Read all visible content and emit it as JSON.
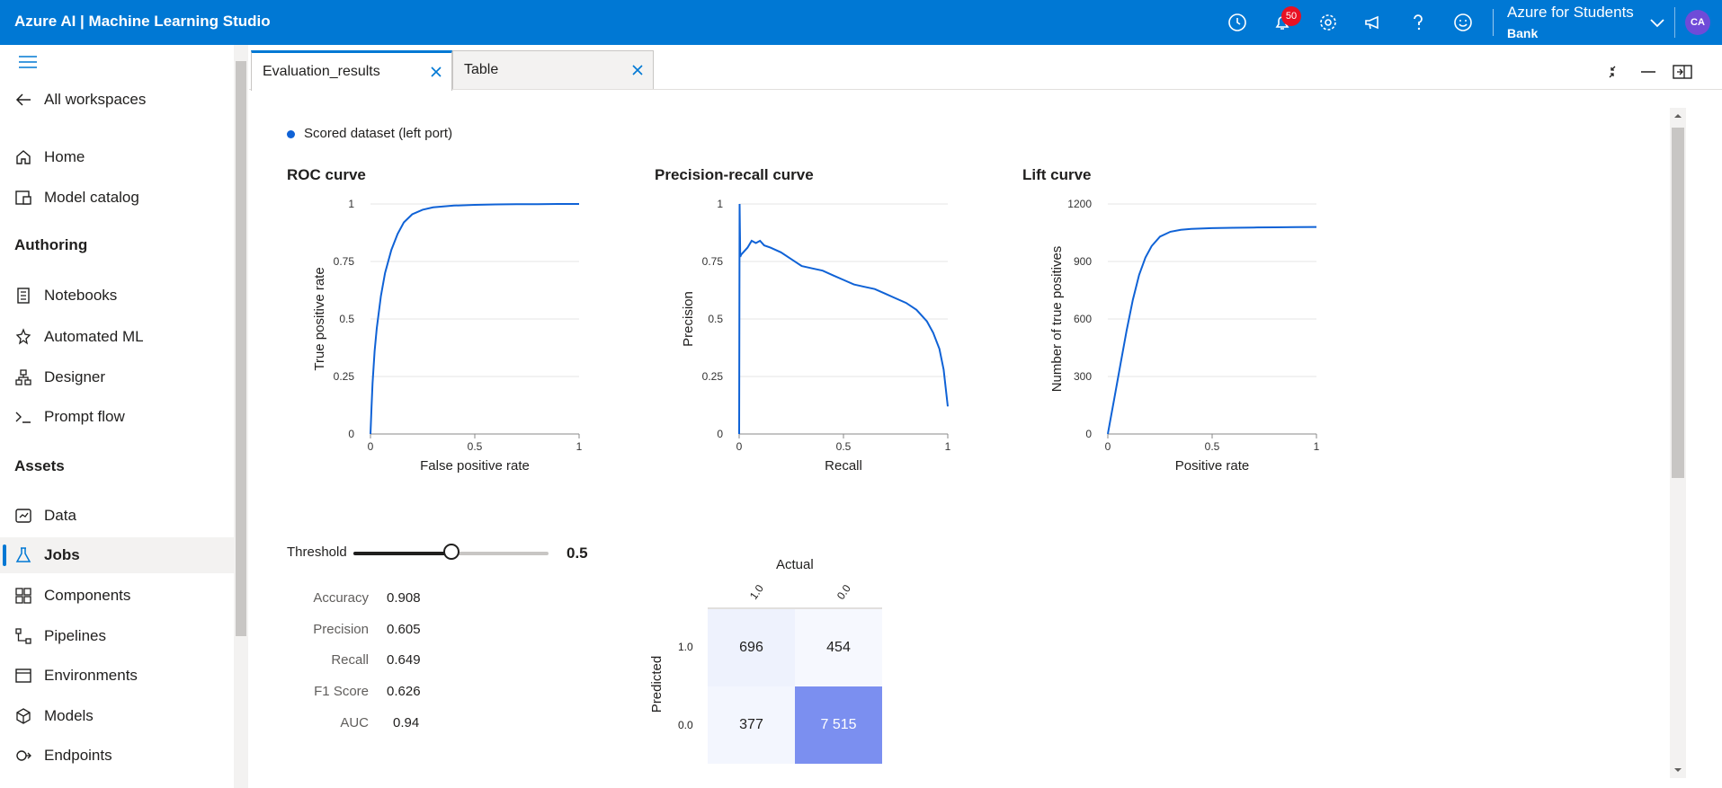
{
  "topbar": {
    "app_title": "Azure AI | Machine Learning Studio",
    "notification_count": "50",
    "account_name": "Azure for Students",
    "workspace_name": "Bank",
    "avatar_initials": "CA",
    "icons": [
      "clock-icon",
      "bell-icon",
      "gear-icon",
      "megaphone-icon",
      "help-icon",
      "smiley-icon",
      "chevron-down-icon"
    ]
  },
  "sidebar": {
    "back_label": "All workspaces",
    "items_top": [
      {
        "label": "Home",
        "icon": "home-icon"
      },
      {
        "label": "Model catalog",
        "icon": "catalog-icon"
      }
    ],
    "section_authoring": "Authoring",
    "items_authoring": [
      {
        "label": "Notebooks",
        "icon": "notebook-icon"
      },
      {
        "label": "Automated ML",
        "icon": "automl-icon"
      },
      {
        "label": "Designer",
        "icon": "designer-icon"
      },
      {
        "label": "Prompt flow",
        "icon": "prompt-icon"
      }
    ],
    "section_assets": "Assets",
    "items_assets": [
      {
        "label": "Data",
        "icon": "data-icon"
      },
      {
        "label": "Jobs",
        "icon": "flask-icon",
        "active": true
      },
      {
        "label": "Components",
        "icon": "components-icon"
      },
      {
        "label": "Pipelines",
        "icon": "pipelines-icon"
      },
      {
        "label": "Environments",
        "icon": "environments-icon"
      },
      {
        "label": "Models",
        "icon": "models-icon"
      },
      {
        "label": "Endpoints",
        "icon": "endpoints-icon"
      }
    ]
  },
  "tabs": [
    {
      "label": "Evaluation_results",
      "active": true
    },
    {
      "label": "Table",
      "active": false
    }
  ],
  "legend": {
    "label": "Scored dataset (left port)",
    "color": "#0f62d6"
  },
  "chart_data": [
    {
      "type": "line",
      "title": "ROC curve",
      "xlabel": "False positive rate",
      "ylabel": "True positive rate",
      "xlim": [
        0,
        1
      ],
      "ylim": [
        0,
        1
      ],
      "xticks": [
        "0",
        "0.5",
        "1"
      ],
      "yticks": [
        "0",
        "0.25",
        "0.5",
        "0.75",
        "1"
      ],
      "x": [
        0,
        0.005,
        0.01,
        0.02,
        0.03,
        0.05,
        0.07,
        0.1,
        0.13,
        0.16,
        0.2,
        0.25,
        0.3,
        0.4,
        0.5,
        0.6,
        0.7,
        0.8,
        0.9,
        1
      ],
      "y": [
        0,
        0.12,
        0.22,
        0.36,
        0.46,
        0.6,
        0.7,
        0.8,
        0.87,
        0.92,
        0.955,
        0.975,
        0.985,
        0.993,
        0.996,
        0.998,
        0.999,
        0.999,
        1,
        1
      ]
    },
    {
      "type": "line",
      "title": "Precision-recall curve",
      "xlabel": "Recall",
      "ylabel": "Precision",
      "xlim": [
        0,
        1
      ],
      "ylim": [
        0,
        1
      ],
      "xticks": [
        "0",
        "0.5",
        "1"
      ],
      "yticks": [
        "0",
        "0.25",
        "0.5",
        "0.75",
        "1"
      ],
      "x": [
        0,
        0.002,
        0.005,
        0.01,
        0.02,
        0.04,
        0.06,
        0.08,
        0.1,
        0.12,
        0.15,
        0.2,
        0.25,
        0.3,
        0.35,
        0.4,
        0.45,
        0.5,
        0.55,
        0.6,
        0.65,
        0.7,
        0.75,
        0.8,
        0.85,
        0.9,
        0.93,
        0.96,
        0.98,
        0.99,
        1
      ],
      "y": [
        0,
        1.0,
        0.77,
        0.78,
        0.79,
        0.81,
        0.84,
        0.83,
        0.84,
        0.82,
        0.81,
        0.79,
        0.76,
        0.73,
        0.72,
        0.71,
        0.69,
        0.67,
        0.65,
        0.64,
        0.63,
        0.61,
        0.59,
        0.57,
        0.54,
        0.49,
        0.44,
        0.37,
        0.28,
        0.2,
        0.12
      ]
    },
    {
      "type": "line",
      "title": "Lift curve",
      "xlabel": "Positive rate",
      "ylabel": "Number of true positives",
      "xlim": [
        0,
        1
      ],
      "ylim": [
        0,
        1200
      ],
      "xticks": [
        "0",
        "0.5",
        "1"
      ],
      "yticks": [
        "0",
        "300",
        "600",
        "900",
        "1200"
      ],
      "x": [
        0,
        0.01,
        0.03,
        0.06,
        0.09,
        0.12,
        0.15,
        0.18,
        0.21,
        0.25,
        0.3,
        0.35,
        0.4,
        0.5,
        0.6,
        0.7,
        0.8,
        0.9,
        1
      ],
      "y": [
        0,
        60,
        180,
        360,
        540,
        700,
        830,
        920,
        980,
        1030,
        1055,
        1065,
        1070,
        1074,
        1076,
        1077,
        1078,
        1079,
        1080
      ]
    }
  ],
  "threshold": {
    "label": "Threshold",
    "value": "0.5",
    "fraction": 0.5
  },
  "metrics": [
    {
      "name": "Accuracy",
      "value": "0.908"
    },
    {
      "name": "Precision",
      "value": "0.605"
    },
    {
      "name": "Recall",
      "value": "0.649"
    },
    {
      "name": "F1 Score",
      "value": "0.626"
    },
    {
      "name": "AUC",
      "value": "0.94"
    }
  ],
  "confusion_matrix": {
    "actual_label": "Actual",
    "predicted_label": "Predicted",
    "col_labels": [
      "1.0",
      "0.0"
    ],
    "row_labels": [
      "1.0",
      "0.0"
    ],
    "cells": [
      [
        "696",
        "454"
      ],
      [
        "377",
        "7 515"
      ]
    ],
    "colors": [
      [
        "#eef2fd",
        "#f6f8fe"
      ],
      [
        "#f3f6fe",
        "#7b8ff0"
      ]
    ]
  },
  "colors": {
    "brand": "#0078d4",
    "line": "#0f62d6"
  }
}
